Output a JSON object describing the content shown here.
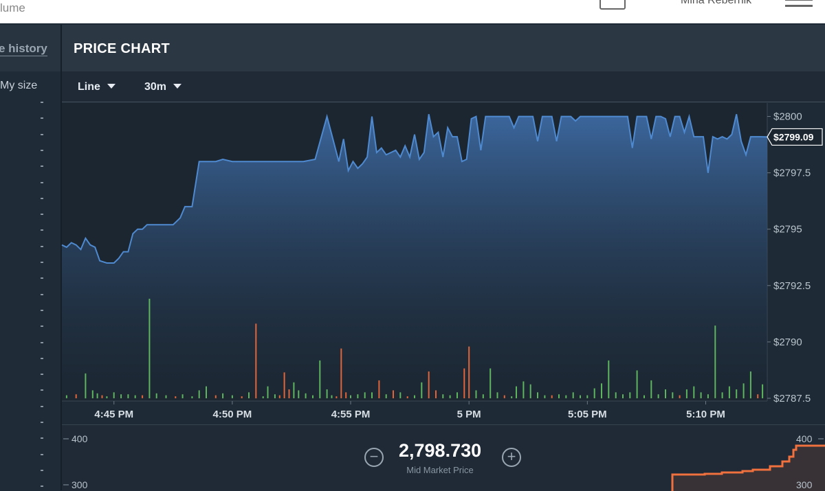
{
  "topbar": {
    "crumb": "lume",
    "user": "Mina Rebernik"
  },
  "left_panel": {
    "tab_label": "e history",
    "size_label": "My size"
  },
  "panel": {
    "title": "PRICE CHART",
    "chart_type": "Line",
    "interval": "30m"
  },
  "depth": {
    "mid_price": "2,798.730",
    "mid_label": "Mid Market Price",
    "left_ticks": [
      "400",
      "300"
    ],
    "right_ticks": [
      "400",
      "300"
    ],
    "minus_glyph": "−",
    "plus_glyph": "+"
  },
  "colors": {
    "line": "#4f8ad0",
    "buy": "#5fb55f",
    "sell": "#e0653a",
    "depth_sell": "#f0703e"
  },
  "chart_data": {
    "type": "line",
    "series_name": "",
    "x_tick_labels": [
      "4:45 PM",
      "4:50 PM",
      "4:55 PM",
      "5 PM",
      "5:05 PM",
      "5:10 PM"
    ],
    "x_ticks_min": [
      0,
      5,
      10,
      15,
      20,
      25
    ],
    "x_range_min": [
      -2.2,
      27.6
    ],
    "y_tick_labels": [
      "$2800",
      "$2797.5",
      "$2795",
      "$2792.5",
      "$2790",
      "$2787.5"
    ],
    "y_ticks": [
      2800,
      2797.5,
      2795,
      2792.5,
      2790,
      2787.5
    ],
    "ylim": [
      2787.5,
      2800.2
    ],
    "current_price_label": "$2799.09",
    "current_price": 2799.09,
    "x_unit": "minutes after 4:45 PM",
    "price_x": [
      -2.2,
      -2.0,
      -1.8,
      -1.6,
      -1.4,
      -1.2,
      -1.0,
      -0.8,
      -0.6,
      -0.3,
      0.0,
      0.2,
      0.4,
      0.6,
      0.8,
      1.0,
      1.2,
      1.4,
      1.6,
      2.0,
      2.2,
      2.5,
      2.8,
      3.0,
      3.3,
      3.6,
      4.0,
      4.3,
      4.6,
      5.0,
      5.3,
      5.6,
      6.0,
      6.5,
      7.0,
      7.5,
      8.0,
      8.5,
      9.0,
      9.5,
      9.7,
      9.9,
      10.1,
      10.3,
      10.5,
      10.7,
      10.9,
      11.1,
      11.3,
      11.5,
      11.7,
      11.9,
      12.1,
      12.3,
      12.5,
      12.7,
      12.9,
      13.1,
      13.3,
      13.5,
      13.7,
      13.9,
      14.1,
      14.3,
      14.5,
      14.7,
      14.9,
      15.1,
      15.3,
      15.5,
      15.7,
      15.9,
      16.1,
      16.3,
      16.5,
      16.7,
      16.9,
      17.1,
      17.3,
      17.5,
      17.7,
      17.9,
      18.1,
      18.3,
      18.5,
      18.7,
      18.9,
      19.1,
      19.3,
      19.5,
      19.7,
      19.9,
      20.1,
      20.3,
      20.5,
      20.7,
      20.9,
      21.1,
      21.3,
      21.5,
      21.7,
      21.9,
      22.1,
      22.3,
      22.5,
      22.7,
      22.9,
      23.1,
      23.3,
      23.5,
      23.7,
      23.9,
      24.1,
      24.3,
      24.5,
      24.7,
      24.9,
      25.1,
      25.3,
      25.5,
      25.7,
      25.9,
      26.1,
      26.3,
      26.5,
      26.7,
      26.9,
      27.1,
      27.3,
      27.6
    ],
    "price_y": [
      2794.3,
      2794.2,
      2794.4,
      2794.3,
      2794.1,
      2794.6,
      2794.3,
      2794.2,
      2793.6,
      2793.5,
      2793.5,
      2793.7,
      2794.0,
      2794.0,
      2794.8,
      2795.0,
      2795.0,
      2795.2,
      2795.2,
      2795.2,
      2795.2,
      2795.2,
      2795.5,
      2796.0,
      2796.0,
      2798.0,
      2798.0,
      2798.0,
      2798.1,
      2798.0,
      2798.0,
      2798.0,
      2798.0,
      2798.0,
      2798.0,
      2798.0,
      2798.0,
      2798.1,
      2800.0,
      2798.0,
      2799.0,
      2797.6,
      2798.0,
      2797.7,
      2797.9,
      2798.2,
      2800.0,
      2798.4,
      2798.6,
      2798.3,
      2798.4,
      2798.5,
      2798.2,
      2798.7,
      2798.2,
      2799.2,
      2798.1,
      2798.4,
      2800.1,
      2799.1,
      2799.3,
      2798.2,
      2799.5,
      2799.1,
      2799.1,
      2798.0,
      2798.1,
      2799.9,
      2800.0,
      2798.5,
      2800.0,
      2800.0,
      2800.0,
      2800.0,
      2800.0,
      2800.0,
      2799.5,
      2800.0,
      2800.0,
      2800.0,
      2800.0,
      2798.9,
      2800.0,
      2800.0,
      2800.0,
      2798.9,
      2800.0,
      2800.0,
      2800.0,
      2799.8,
      2800.0,
      2800.0,
      2800.0,
      2800.0,
      2800.0,
      2800.0,
      2800.0,
      2800.0,
      2800.0,
      2800.0,
      2800.0,
      2798.6,
      2800.0,
      2800.0,
      2800.0,
      2799.0,
      2800.0,
      2800.0,
      2799.9,
      2799.1,
      2800.0,
      2800.0,
      2799.3,
      2800.0,
      2799.1,
      2799.1,
      2799.1,
      2797.5,
      2799.1,
      2799.0,
      2799.1,
      2799.0,
      2799.2,
      2800.1,
      2798.9,
      2798.3,
      2799.1,
      2799.1,
      2799.1,
      2799.09
    ],
    "volume_x": [
      -2.0,
      -1.6,
      -1.2,
      -0.9,
      -0.7,
      -0.5,
      -0.3,
      0.0,
      0.3,
      0.6,
      0.9,
      1.2,
      1.5,
      1.8,
      2.2,
      2.6,
      2.9,
      3.3,
      3.6,
      3.9,
      4.3,
      4.6,
      5.0,
      5.4,
      5.7,
      6.0,
      6.3,
      6.5,
      6.8,
      7.0,
      7.2,
      7.4,
      7.6,
      7.8,
      8.1,
      8.4,
      8.7,
      9.0,
      9.2,
      9.4,
      9.6,
      9.8,
      10.0,
      10.3,
      10.6,
      10.9,
      11.2,
      11.5,
      11.8,
      12.1,
      12.4,
      12.7,
      13.0,
      13.3,
      13.6,
      13.9,
      14.2,
      14.5,
      14.8,
      15.0,
      15.3,
      15.6,
      15.9,
      16.2,
      16.5,
      16.8,
      17.0,
      17.3,
      17.6,
      17.9,
      18.2,
      18.5,
      18.8,
      19.1,
      19.4,
      19.7,
      20.0,
      20.3,
      20.6,
      20.9,
      21.2,
      21.5,
      21.8,
      22.1,
      22.4,
      22.7,
      23.0,
      23.3,
      23.6,
      23.9,
      24.2,
      24.5,
      24.8,
      25.1,
      25.4,
      25.7,
      26.0,
      26.3,
      26.6,
      26.9,
      27.2,
      27.4
    ],
    "volume": [
      3,
      4,
      25,
      8,
      5,
      3,
      2,
      6,
      4,
      4,
      3,
      3,
      100,
      5,
      3,
      2,
      4,
      2,
      8,
      12,
      3,
      5,
      3,
      2,
      6,
      75,
      2,
      12,
      4,
      3,
      26,
      9,
      16,
      8,
      5,
      3,
      38,
      9,
      3,
      2,
      50,
      6,
      3,
      4,
      6,
      6,
      18,
      4,
      8,
      6,
      2,
      3,
      16,
      27,
      8,
      4,
      3,
      6,
      30,
      52,
      8,
      4,
      30,
      6,
      3,
      2,
      12,
      17,
      14,
      6,
      3,
      3,
      4,
      3,
      6,
      3,
      3,
      10,
      15,
      38,
      6,
      4,
      6,
      28,
      3,
      18,
      4,
      9,
      6,
      3,
      9,
      12,
      6,
      4,
      73,
      6,
      12,
      9,
      15,
      27,
      4,
      14,
      8
    ],
    "volume_side": [
      "b",
      "s",
      "b",
      "b",
      "b",
      "s",
      "b",
      "b",
      "b",
      "b",
      "b",
      "s",
      "b",
      "b",
      "b",
      "s",
      "b",
      "b",
      "b",
      "b",
      "s",
      "b",
      "b",
      "s",
      "b",
      "s",
      "b",
      "b",
      "b",
      "s",
      "s",
      "s",
      "b",
      "b",
      "b",
      "b",
      "b",
      "b",
      "b",
      "s",
      "s",
      "s",
      "b",
      "b",
      "b",
      "b",
      "s",
      "b",
      "s",
      "b",
      "s",
      "b",
      "b",
      "s",
      "s",
      "b",
      "b",
      "b",
      "s",
      "s",
      "b",
      "b",
      "b",
      "b",
      "s",
      "b",
      "b",
      "b",
      "b",
      "b",
      "b",
      "s",
      "b",
      "b",
      "b",
      "b",
      "b",
      "b",
      "b",
      "b",
      "b",
      "b",
      "b",
      "b",
      "b",
      "b",
      "b",
      "b",
      "b",
      "s",
      "b",
      "b",
      "b",
      "b",
      "b",
      "b",
      "b",
      "b",
      "b",
      "b",
      "s",
      "b",
      "b"
    ],
    "volume_max": 100
  }
}
